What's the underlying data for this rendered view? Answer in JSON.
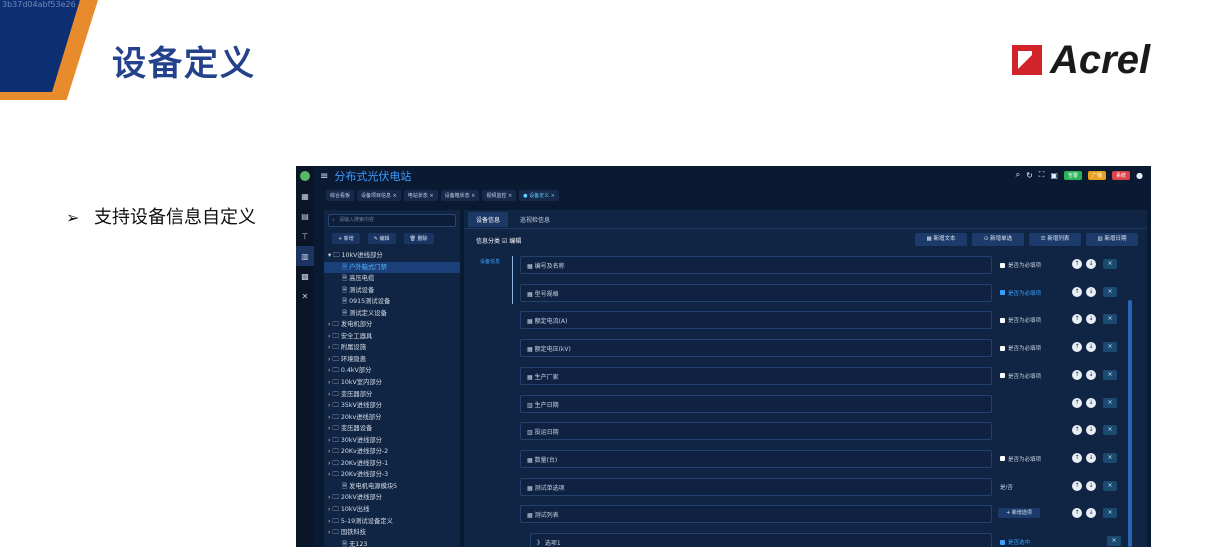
{
  "slide": {
    "title": "设备定义",
    "logo_text": "Acrel",
    "bullet": "支持设备信息自定义",
    "watermark": "3b37d04abf53e26"
  },
  "app": {
    "title": "分布式光伏电站",
    "breadcrumbs": [
      "综合看板",
      "设备项目信息 ×",
      "电站状态 ×",
      "设备箱状态 ×",
      "视频监控 ×",
      "● 设备定义 ×"
    ],
    "top_badges": [
      "告警",
      "广播",
      "系统"
    ],
    "search_placeholder": "请输入搜索内容",
    "tree_buttons": [
      "+ 新增",
      "✎ 编辑",
      "🗑 删除"
    ],
    "tree": [
      {
        "label": "10kV进线部分",
        "level": 0,
        "expanded": true
      },
      {
        "label": "户外箱式门禁",
        "level": 1,
        "selected": true
      },
      {
        "label": "高压电缆",
        "level": 1
      },
      {
        "label": "测试设备",
        "level": 1
      },
      {
        "label": "0915测试设备",
        "level": 1
      },
      {
        "label": "测试定义设备",
        "level": 1
      },
      {
        "label": "发电机部分",
        "level": 0
      },
      {
        "label": "安全工器具",
        "level": 0
      },
      {
        "label": "附属设施",
        "level": 0
      },
      {
        "label": "环境隐患",
        "level": 0
      },
      {
        "label": "0.4kV部分",
        "level": 0
      },
      {
        "label": "10kV室内部分",
        "level": 0
      },
      {
        "label": "变压器部分",
        "level": 0
      },
      {
        "label": "35kV进线部分",
        "level": 0
      },
      {
        "label": "20kv进线部分",
        "level": 0
      },
      {
        "label": "变压器设备",
        "level": 0
      },
      {
        "label": "30kV进线部分",
        "level": 0
      },
      {
        "label": "20Kv进线部分-2",
        "level": 0
      },
      {
        "label": "20Kv进线部分-1",
        "level": 0
      },
      {
        "label": "20Kv进线部分-3",
        "level": 0
      },
      {
        "label": "发电机电源模块5",
        "level": 1
      },
      {
        "label": "20kV进线部分",
        "level": 0
      },
      {
        "label": "10kV出线",
        "level": 0
      },
      {
        "label": "5-19测试设备定义",
        "level": 0
      },
      {
        "label": "国铁科技",
        "level": 0
      },
      {
        "label": "无123",
        "level": 1
      }
    ],
    "tabs": [
      "设备信息",
      "巡视检信息"
    ],
    "category_label": "信息分类 ☑ 编辑",
    "side_note": "设备信息",
    "tool_buttons": [
      "▦ 新增文本",
      "⊙ 新增单选",
      "☰ 新增列表",
      "▥ 新增日期"
    ],
    "fields": [
      {
        "label": "▦ 编号及名称",
        "extra": "checkbox",
        "text": "是否为必填项",
        "checked": false
      },
      {
        "label": "▦ 型号规格",
        "extra": "checkbox",
        "text": "是否为必填项",
        "checked": true
      },
      {
        "label": "▦ 额定电流(A)",
        "extra": "checkbox",
        "text": "是否为必填项",
        "checked": false
      },
      {
        "label": "▦ 额定电压(kV)",
        "extra": "checkbox",
        "text": "是否为必填项",
        "checked": false
      },
      {
        "label": "▦ 生产厂家",
        "extra": "checkbox",
        "text": "是否为必填项",
        "checked": false
      },
      {
        "label": "▥ 生产日期",
        "extra": "none",
        "text": ""
      },
      {
        "label": "▥ 投运日期",
        "extra": "none",
        "text": ""
      },
      {
        "label": "▦ 数量(台)",
        "extra": "checkbox",
        "text": "是否为必填项",
        "checked": false
      },
      {
        "label": "▦ 测试单选项",
        "extra": "text",
        "text": "是/否"
      },
      {
        "label": "▦ 测试列表",
        "extra": "button",
        "text": "+ 新增选项"
      },
      {
        "label": "》 选项1",
        "extra": "checkbox",
        "text": "是否选中",
        "checked": true,
        "indent": true
      }
    ],
    "colors": {
      "accent": "#3d9cff",
      "bg": "#0b1a33",
      "panel": "#102544"
    }
  }
}
